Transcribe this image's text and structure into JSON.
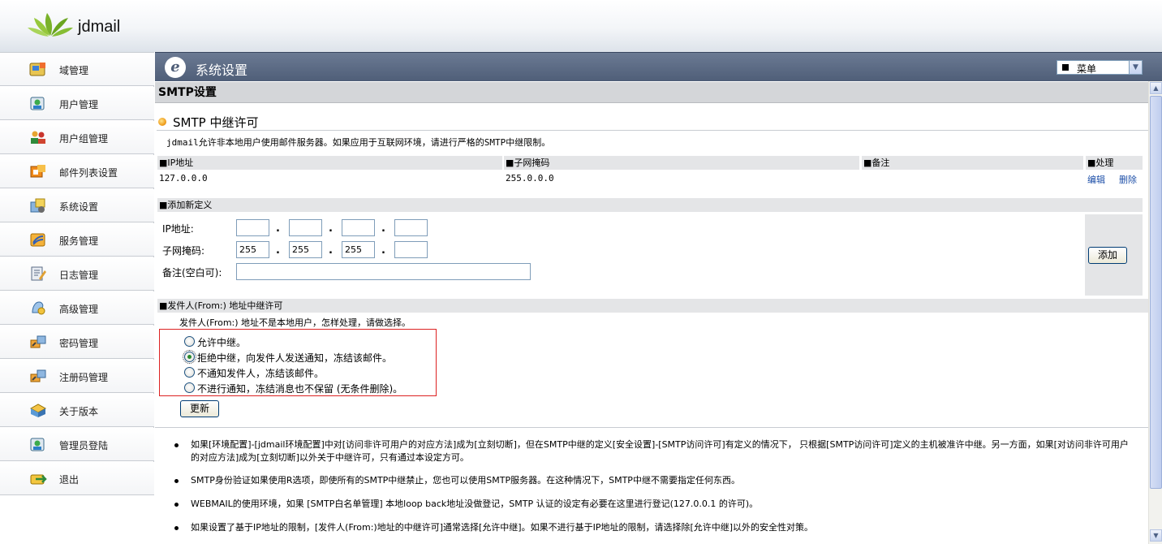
{
  "app": {
    "name": "jdmail"
  },
  "sidebar": {
    "items": [
      {
        "label": "域管理",
        "icon": "domain-icon"
      },
      {
        "label": "用户管理",
        "icon": "user-icon"
      },
      {
        "label": "用户组管理",
        "icon": "group-icon"
      },
      {
        "label": "邮件列表设置",
        "icon": "mailing-list-icon"
      },
      {
        "label": "系统设置",
        "icon": "system-settings-icon"
      },
      {
        "label": "服务管理",
        "icon": "service-icon"
      },
      {
        "label": "日志管理",
        "icon": "log-icon"
      },
      {
        "label": "高级管理",
        "icon": "advanced-icon"
      },
      {
        "label": "密码管理",
        "icon": "password-icon"
      },
      {
        "label": "注册码管理",
        "icon": "registration-icon"
      },
      {
        "label": "关于版本",
        "icon": "about-icon"
      },
      {
        "label": "管理员登陆",
        "icon": "admin-login-icon"
      },
      {
        "label": "退出",
        "icon": "logout-icon"
      }
    ]
  },
  "header": {
    "title": "系统设置",
    "menu_label": "菜单"
  },
  "section": {
    "title": "SMTP设置",
    "subtitle": "SMTP 中继许可",
    "description": "jdmail允许非本地用户使用邮件服务器。如果应用于互联网环境，请进行严格的SMTP中继限制。"
  },
  "relay_table": {
    "headers": [
      "■IP地址",
      "■子网掩码",
      "■备注",
      "■处理"
    ],
    "rows": [
      {
        "ip": "127.0.0.0",
        "mask": "255.0.0.0",
        "note": "",
        "edit": "编辑",
        "delete": "删除"
      }
    ]
  },
  "add_form": {
    "heading": "■添加新定义",
    "ip_label": "IP地址:",
    "mask_label": "子网掩码:",
    "note_label": "备注(空白可):",
    "ip_values": [
      "",
      "",
      "",
      ""
    ],
    "mask_values": [
      "255",
      "255",
      "255",
      ""
    ],
    "dot": ".",
    "add_button": "添加"
  },
  "from_relay": {
    "heading": "■发件人(From:) 地址中继许可",
    "description": "发件人(From:) 地址不是本地用户，怎样处理，请做选择。",
    "options": [
      {
        "label": "允许中继。",
        "checked": false
      },
      {
        "label": "拒绝中继，向发件人发送通知，冻结该邮件。",
        "checked": true
      },
      {
        "label": "不通知发件人，冻结该邮件。",
        "checked": false
      },
      {
        "label": "不进行通知，冻结消息也不保留 (无条件删除)。",
        "checked": false
      }
    ],
    "update_button": "更新"
  },
  "notes": [
    "如果[环境配置]-[jdmail环境配置]中对[访问非许可用户的对应方法]成为[立刻切断]，但在SMTP中继的定义[安全设置]-[SMTP访问许可]有定义的情况下， 只根据[SMTP访问许可]定义的主机被准许中继。另一方面，如果[对访问非许可用户的对应方法]成为[立刻切断]以外关于中继许可，只有通过本设定方可。",
    "SMTP身份验证如果使用R选项，即使所有的SMTP中继禁止，您也可以使用SMTP服务器。在这种情况下，SMTP中继不需要指定任何东西。",
    "WEBMAIL的使用环境，如果 [SMTP白名单管理] 本地loop back地址没做登记，SMTP 认证的设定有必要在这里进行登记(127.0.0.1 的许可)。",
    "如果设置了基于IP地址的限制，[发件人(From:)地址的中继许可]通常选择[允许中继]。如果不进行基于IP地址的限制，请选择除[允许中继]以外的安全性对策。"
  ]
}
